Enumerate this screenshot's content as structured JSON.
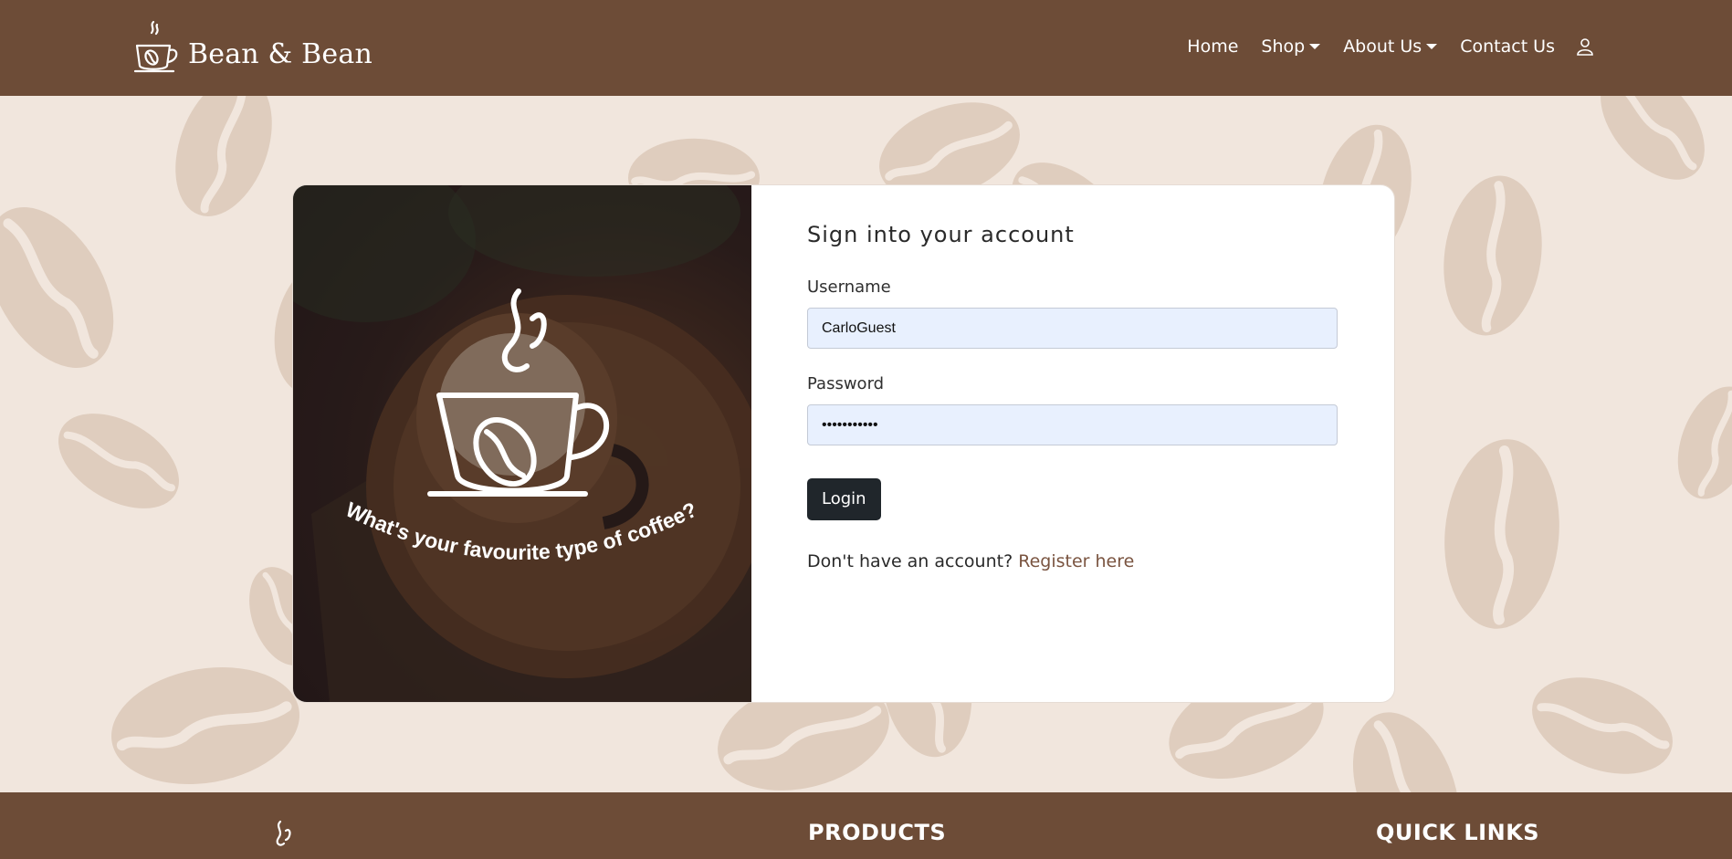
{
  "header": {
    "brand_name": "Bean & Bean",
    "nav": {
      "home": "Home",
      "shop": "Shop",
      "about": "About Us",
      "contact": "Contact Us"
    }
  },
  "hero_image": {
    "tagline": "What's your favourite type of coffee?"
  },
  "login": {
    "heading": "Sign into your account",
    "username_label": "Username",
    "username_value": "CarloGuest",
    "password_label": "Password",
    "password_value": "•••••••••••",
    "login_button": "Login",
    "register_prompt": "Don't have an account?",
    "register_link": "Register here"
  },
  "footer": {
    "products_heading": "PRODUCTS",
    "quick_links_heading": "QUICK LINKS"
  },
  "colors": {
    "header_bg": "#6d4c37",
    "page_bg": "#f1e6dd",
    "bean_color": "#dfcdbe",
    "input_bg": "#e8f0fe",
    "button_bg": "#20262b",
    "link_color": "#7a5440"
  },
  "icons": {
    "brand": "coffee-cup-logo-icon",
    "account": "user-icon",
    "dropdown": "caret-down-icon"
  }
}
